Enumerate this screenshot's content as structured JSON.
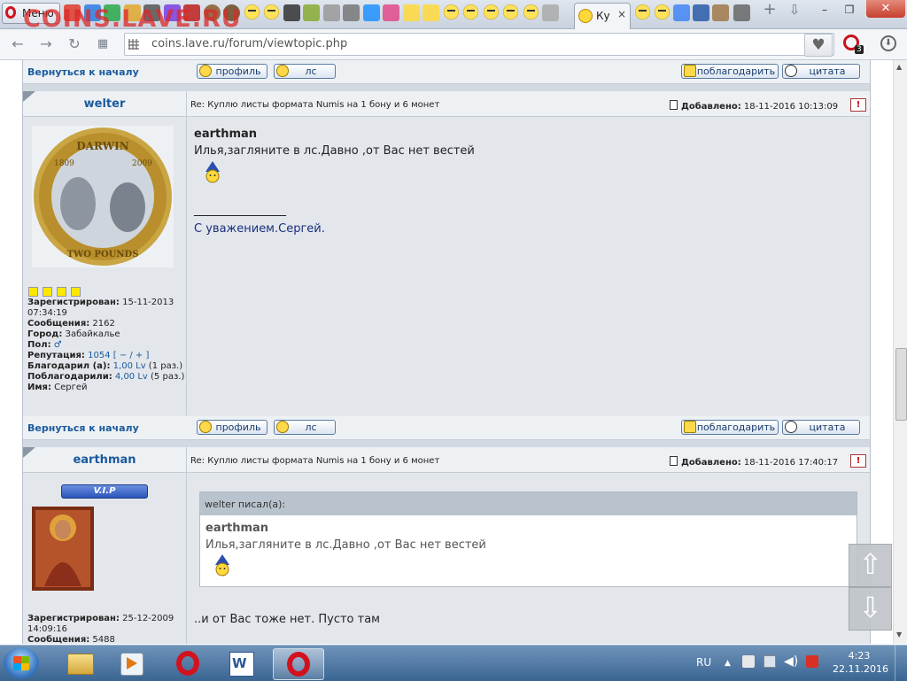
{
  "browser": {
    "menu_label": "Меню",
    "active_tab_label": "Ку",
    "active_tab_close": "×",
    "watermark": "COINS.LAVE.RU",
    "url": "coins.lave.ru/forum/viewtopic.php",
    "badge_count": "3",
    "icons": {
      "back": "arrow-left-icon",
      "forward": "arrow-right-icon",
      "reload": "reload-icon",
      "speed_dial": "grid-icon",
      "bookmark": "heart-icon",
      "downloads": "download-icon",
      "new_tab": "plus-icon",
      "tab_menu": "chevron-down-icon"
    },
    "window_controls": {
      "minimize": "–",
      "maximize": "❐",
      "close": "✕"
    },
    "nav_glyphs": {
      "back": "←",
      "forward": "→",
      "reload": "↻",
      "heart": "♥",
      "download": "⬇",
      "new_tab": "+",
      "tab_menu": "⇩"
    }
  },
  "forum": {
    "back_to_top": "Вернуться к началу",
    "buttons": {
      "profile": "профиль",
      "pm": "лс",
      "thanks": "поблагодарить",
      "quote": "цитата"
    },
    "report": "!",
    "added_label": "Добавлено:",
    "posts": [
      {
        "author": "welter",
        "subject": "Re: Куплю листы формата Numis на 1 бону и 6 монет",
        "date": "18-11-2016 10:13:09",
        "avatar": "darwin-coin-avatar",
        "avatar_text_top": "DARWIN",
        "avatar_text_bottom": "TWO POUNDS",
        "avatar_years": [
          "1809",
          "2009"
        ],
        "profile": {
          "registered_label": "Зарегистрирован:",
          "registered": "15-11-2013 07:34:19",
          "messages_label": "Сообщения:",
          "messages": "2162",
          "city_label": "Город:",
          "city": "Забайкалье",
          "gender_label": "Пол:",
          "gender_icon": "♂",
          "reputation_label": "Репутация:",
          "reputation": "1054",
          "reputation_controls": "[ − / + ]",
          "thanked_label": "Благодарил (а):",
          "thanked": "1,00 Lv",
          "thanked_count": "(1 раз.)",
          "was_thanked_label": "Поблагодарили:",
          "was_thanked": "4,00 Lv",
          "was_thanked_count": "(5 раз.)",
          "name_label": "Имя:",
          "name": "Сергей"
        },
        "body": {
          "quote_name": "earthman",
          "text": "Илья,загляните в лс.Давно ,от Вас нет вестей",
          "signature_line": "________________",
          "signature": "С уважением.Сергей."
        }
      },
      {
        "author": "earthman",
        "subject": "Re: Куплю листы формата Numis на 1 бону и 6 монет",
        "date": "18-11-2016 17:40:17",
        "vip": "V.I.P",
        "avatar": "icon-saint-avatar",
        "profile": {
          "registered_label": "Зарегистрирован:",
          "registered": "25-12-2009 14:09:16",
          "messages_label": "Сообщения:",
          "messages": "5488"
        },
        "quote": {
          "header": "welter писал(а):",
          "name": "earthman",
          "text": "Илья,загляните в лс.Давно ,от Вас нет вестей"
        },
        "text": "..и от Вас тоже нет. Пусто там"
      }
    ],
    "scroll_up": "⇧",
    "scroll_down": "⇩"
  },
  "taskbar": {
    "language": "RU",
    "time": "4:23",
    "date": "22.11.2016",
    "apps": [
      "windows-explorer",
      "media-player",
      "opera",
      "word",
      "opera-active"
    ]
  },
  "colors": {
    "link": "#1a5a9c",
    "taskbar": "#3a6592",
    "watermark": "#dc2828",
    "opera": "#d2121d"
  }
}
